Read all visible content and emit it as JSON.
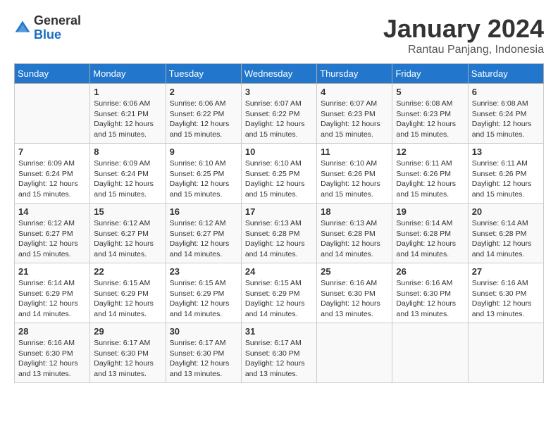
{
  "header": {
    "logo_line1": "General",
    "logo_line2": "Blue",
    "month_title": "January 2024",
    "location": "Rantau Panjang, Indonesia"
  },
  "weekdays": [
    "Sunday",
    "Monday",
    "Tuesday",
    "Wednesday",
    "Thursday",
    "Friday",
    "Saturday"
  ],
  "weeks": [
    [
      {
        "day": "",
        "sunrise": "",
        "sunset": "",
        "daylight": ""
      },
      {
        "day": "1",
        "sunrise": "Sunrise: 6:06 AM",
        "sunset": "Sunset: 6:21 PM",
        "daylight": "Daylight: 12 hours and 15 minutes."
      },
      {
        "day": "2",
        "sunrise": "Sunrise: 6:06 AM",
        "sunset": "Sunset: 6:22 PM",
        "daylight": "Daylight: 12 hours and 15 minutes."
      },
      {
        "day": "3",
        "sunrise": "Sunrise: 6:07 AM",
        "sunset": "Sunset: 6:22 PM",
        "daylight": "Daylight: 12 hours and 15 minutes."
      },
      {
        "day": "4",
        "sunrise": "Sunrise: 6:07 AM",
        "sunset": "Sunset: 6:23 PM",
        "daylight": "Daylight: 12 hours and 15 minutes."
      },
      {
        "day": "5",
        "sunrise": "Sunrise: 6:08 AM",
        "sunset": "Sunset: 6:23 PM",
        "daylight": "Daylight: 12 hours and 15 minutes."
      },
      {
        "day": "6",
        "sunrise": "Sunrise: 6:08 AM",
        "sunset": "Sunset: 6:24 PM",
        "daylight": "Daylight: 12 hours and 15 minutes."
      }
    ],
    [
      {
        "day": "7",
        "sunrise": "Sunrise: 6:09 AM",
        "sunset": "Sunset: 6:24 PM",
        "daylight": "Daylight: 12 hours and 15 minutes."
      },
      {
        "day": "8",
        "sunrise": "Sunrise: 6:09 AM",
        "sunset": "Sunset: 6:24 PM",
        "daylight": "Daylight: 12 hours and 15 minutes."
      },
      {
        "day": "9",
        "sunrise": "Sunrise: 6:10 AM",
        "sunset": "Sunset: 6:25 PM",
        "daylight": "Daylight: 12 hours and 15 minutes."
      },
      {
        "day": "10",
        "sunrise": "Sunrise: 6:10 AM",
        "sunset": "Sunset: 6:25 PM",
        "daylight": "Daylight: 12 hours and 15 minutes."
      },
      {
        "day": "11",
        "sunrise": "Sunrise: 6:10 AM",
        "sunset": "Sunset: 6:26 PM",
        "daylight": "Daylight: 12 hours and 15 minutes."
      },
      {
        "day": "12",
        "sunrise": "Sunrise: 6:11 AM",
        "sunset": "Sunset: 6:26 PM",
        "daylight": "Daylight: 12 hours and 15 minutes."
      },
      {
        "day": "13",
        "sunrise": "Sunrise: 6:11 AM",
        "sunset": "Sunset: 6:26 PM",
        "daylight": "Daylight: 12 hours and 15 minutes."
      }
    ],
    [
      {
        "day": "14",
        "sunrise": "Sunrise: 6:12 AM",
        "sunset": "Sunset: 6:27 PM",
        "daylight": "Daylight: 12 hours and 15 minutes."
      },
      {
        "day": "15",
        "sunrise": "Sunrise: 6:12 AM",
        "sunset": "Sunset: 6:27 PM",
        "daylight": "Daylight: 12 hours and 14 minutes."
      },
      {
        "day": "16",
        "sunrise": "Sunrise: 6:12 AM",
        "sunset": "Sunset: 6:27 PM",
        "daylight": "Daylight: 12 hours and 14 minutes."
      },
      {
        "day": "17",
        "sunrise": "Sunrise: 6:13 AM",
        "sunset": "Sunset: 6:28 PM",
        "daylight": "Daylight: 12 hours and 14 minutes."
      },
      {
        "day": "18",
        "sunrise": "Sunrise: 6:13 AM",
        "sunset": "Sunset: 6:28 PM",
        "daylight": "Daylight: 12 hours and 14 minutes."
      },
      {
        "day": "19",
        "sunrise": "Sunrise: 6:14 AM",
        "sunset": "Sunset: 6:28 PM",
        "daylight": "Daylight: 12 hours and 14 minutes."
      },
      {
        "day": "20",
        "sunrise": "Sunrise: 6:14 AM",
        "sunset": "Sunset: 6:28 PM",
        "daylight": "Daylight: 12 hours and 14 minutes."
      }
    ],
    [
      {
        "day": "21",
        "sunrise": "Sunrise: 6:14 AM",
        "sunset": "Sunset: 6:29 PM",
        "daylight": "Daylight: 12 hours and 14 minutes."
      },
      {
        "day": "22",
        "sunrise": "Sunrise: 6:15 AM",
        "sunset": "Sunset: 6:29 PM",
        "daylight": "Daylight: 12 hours and 14 minutes."
      },
      {
        "day": "23",
        "sunrise": "Sunrise: 6:15 AM",
        "sunset": "Sunset: 6:29 PM",
        "daylight": "Daylight: 12 hours and 14 minutes."
      },
      {
        "day": "24",
        "sunrise": "Sunrise: 6:15 AM",
        "sunset": "Sunset: 6:29 PM",
        "daylight": "Daylight: 12 hours and 14 minutes."
      },
      {
        "day": "25",
        "sunrise": "Sunrise: 6:16 AM",
        "sunset": "Sunset: 6:30 PM",
        "daylight": "Daylight: 12 hours and 13 minutes."
      },
      {
        "day": "26",
        "sunrise": "Sunrise: 6:16 AM",
        "sunset": "Sunset: 6:30 PM",
        "daylight": "Daylight: 12 hours and 13 minutes."
      },
      {
        "day": "27",
        "sunrise": "Sunrise: 6:16 AM",
        "sunset": "Sunset: 6:30 PM",
        "daylight": "Daylight: 12 hours and 13 minutes."
      }
    ],
    [
      {
        "day": "28",
        "sunrise": "Sunrise: 6:16 AM",
        "sunset": "Sunset: 6:30 PM",
        "daylight": "Daylight: 12 hours and 13 minutes."
      },
      {
        "day": "29",
        "sunrise": "Sunrise: 6:17 AM",
        "sunset": "Sunset: 6:30 PM",
        "daylight": "Daylight: 12 hours and 13 minutes."
      },
      {
        "day": "30",
        "sunrise": "Sunrise: 6:17 AM",
        "sunset": "Sunset: 6:30 PM",
        "daylight": "Daylight: 12 hours and 13 minutes."
      },
      {
        "day": "31",
        "sunrise": "Sunrise: 6:17 AM",
        "sunset": "Sunset: 6:30 PM",
        "daylight": "Daylight: 12 hours and 13 minutes."
      },
      {
        "day": "",
        "sunrise": "",
        "sunset": "",
        "daylight": ""
      },
      {
        "day": "",
        "sunrise": "",
        "sunset": "",
        "daylight": ""
      },
      {
        "day": "",
        "sunrise": "",
        "sunset": "",
        "daylight": ""
      }
    ]
  ]
}
